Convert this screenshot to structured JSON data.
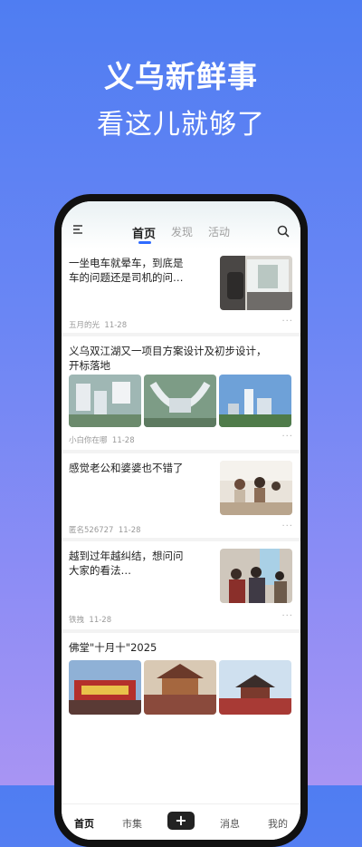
{
  "promo": {
    "title": "义乌新鲜事",
    "subtitle": "看这儿就够了"
  },
  "header": {
    "tabs": [
      {
        "label": "首页",
        "active": true
      },
      {
        "label": "发现",
        "active": false
      },
      {
        "label": "活动",
        "active": false
      }
    ],
    "icons": {
      "menu": "menu-icon",
      "search": "search-icon"
    }
  },
  "feed": [
    {
      "title_line1": "一坐电车就晕车，到底是",
      "title_line2": "车的问题还是司机的问…",
      "author": "五月的光",
      "date": "11-28"
    },
    {
      "title_line1": "义乌双江湖又一项目方案设计及初步设计，",
      "title_line2": "开标落地",
      "author": "小白你在哪",
      "date": "11-28"
    },
    {
      "title_line1": "感觉老公和婆婆也不错了",
      "author": "匿名526727",
      "date": "11-28"
    },
    {
      "title_line1": "越到过年越纠结，想问问",
      "title_line2": "大家的看法…",
      "author": "铁拽",
      "date": "11-28"
    },
    {
      "title_line1": "佛堂\"十月十\"2025"
    }
  ],
  "more_label": "···",
  "bottom_nav": {
    "home": "首页",
    "market": "市集",
    "add": "+",
    "messages": "消息",
    "mine": "我的"
  },
  "colors": {
    "accent": "#2f6bff",
    "bg_top": "#4f7df2",
    "bg_bottom": "#a894f3"
  }
}
